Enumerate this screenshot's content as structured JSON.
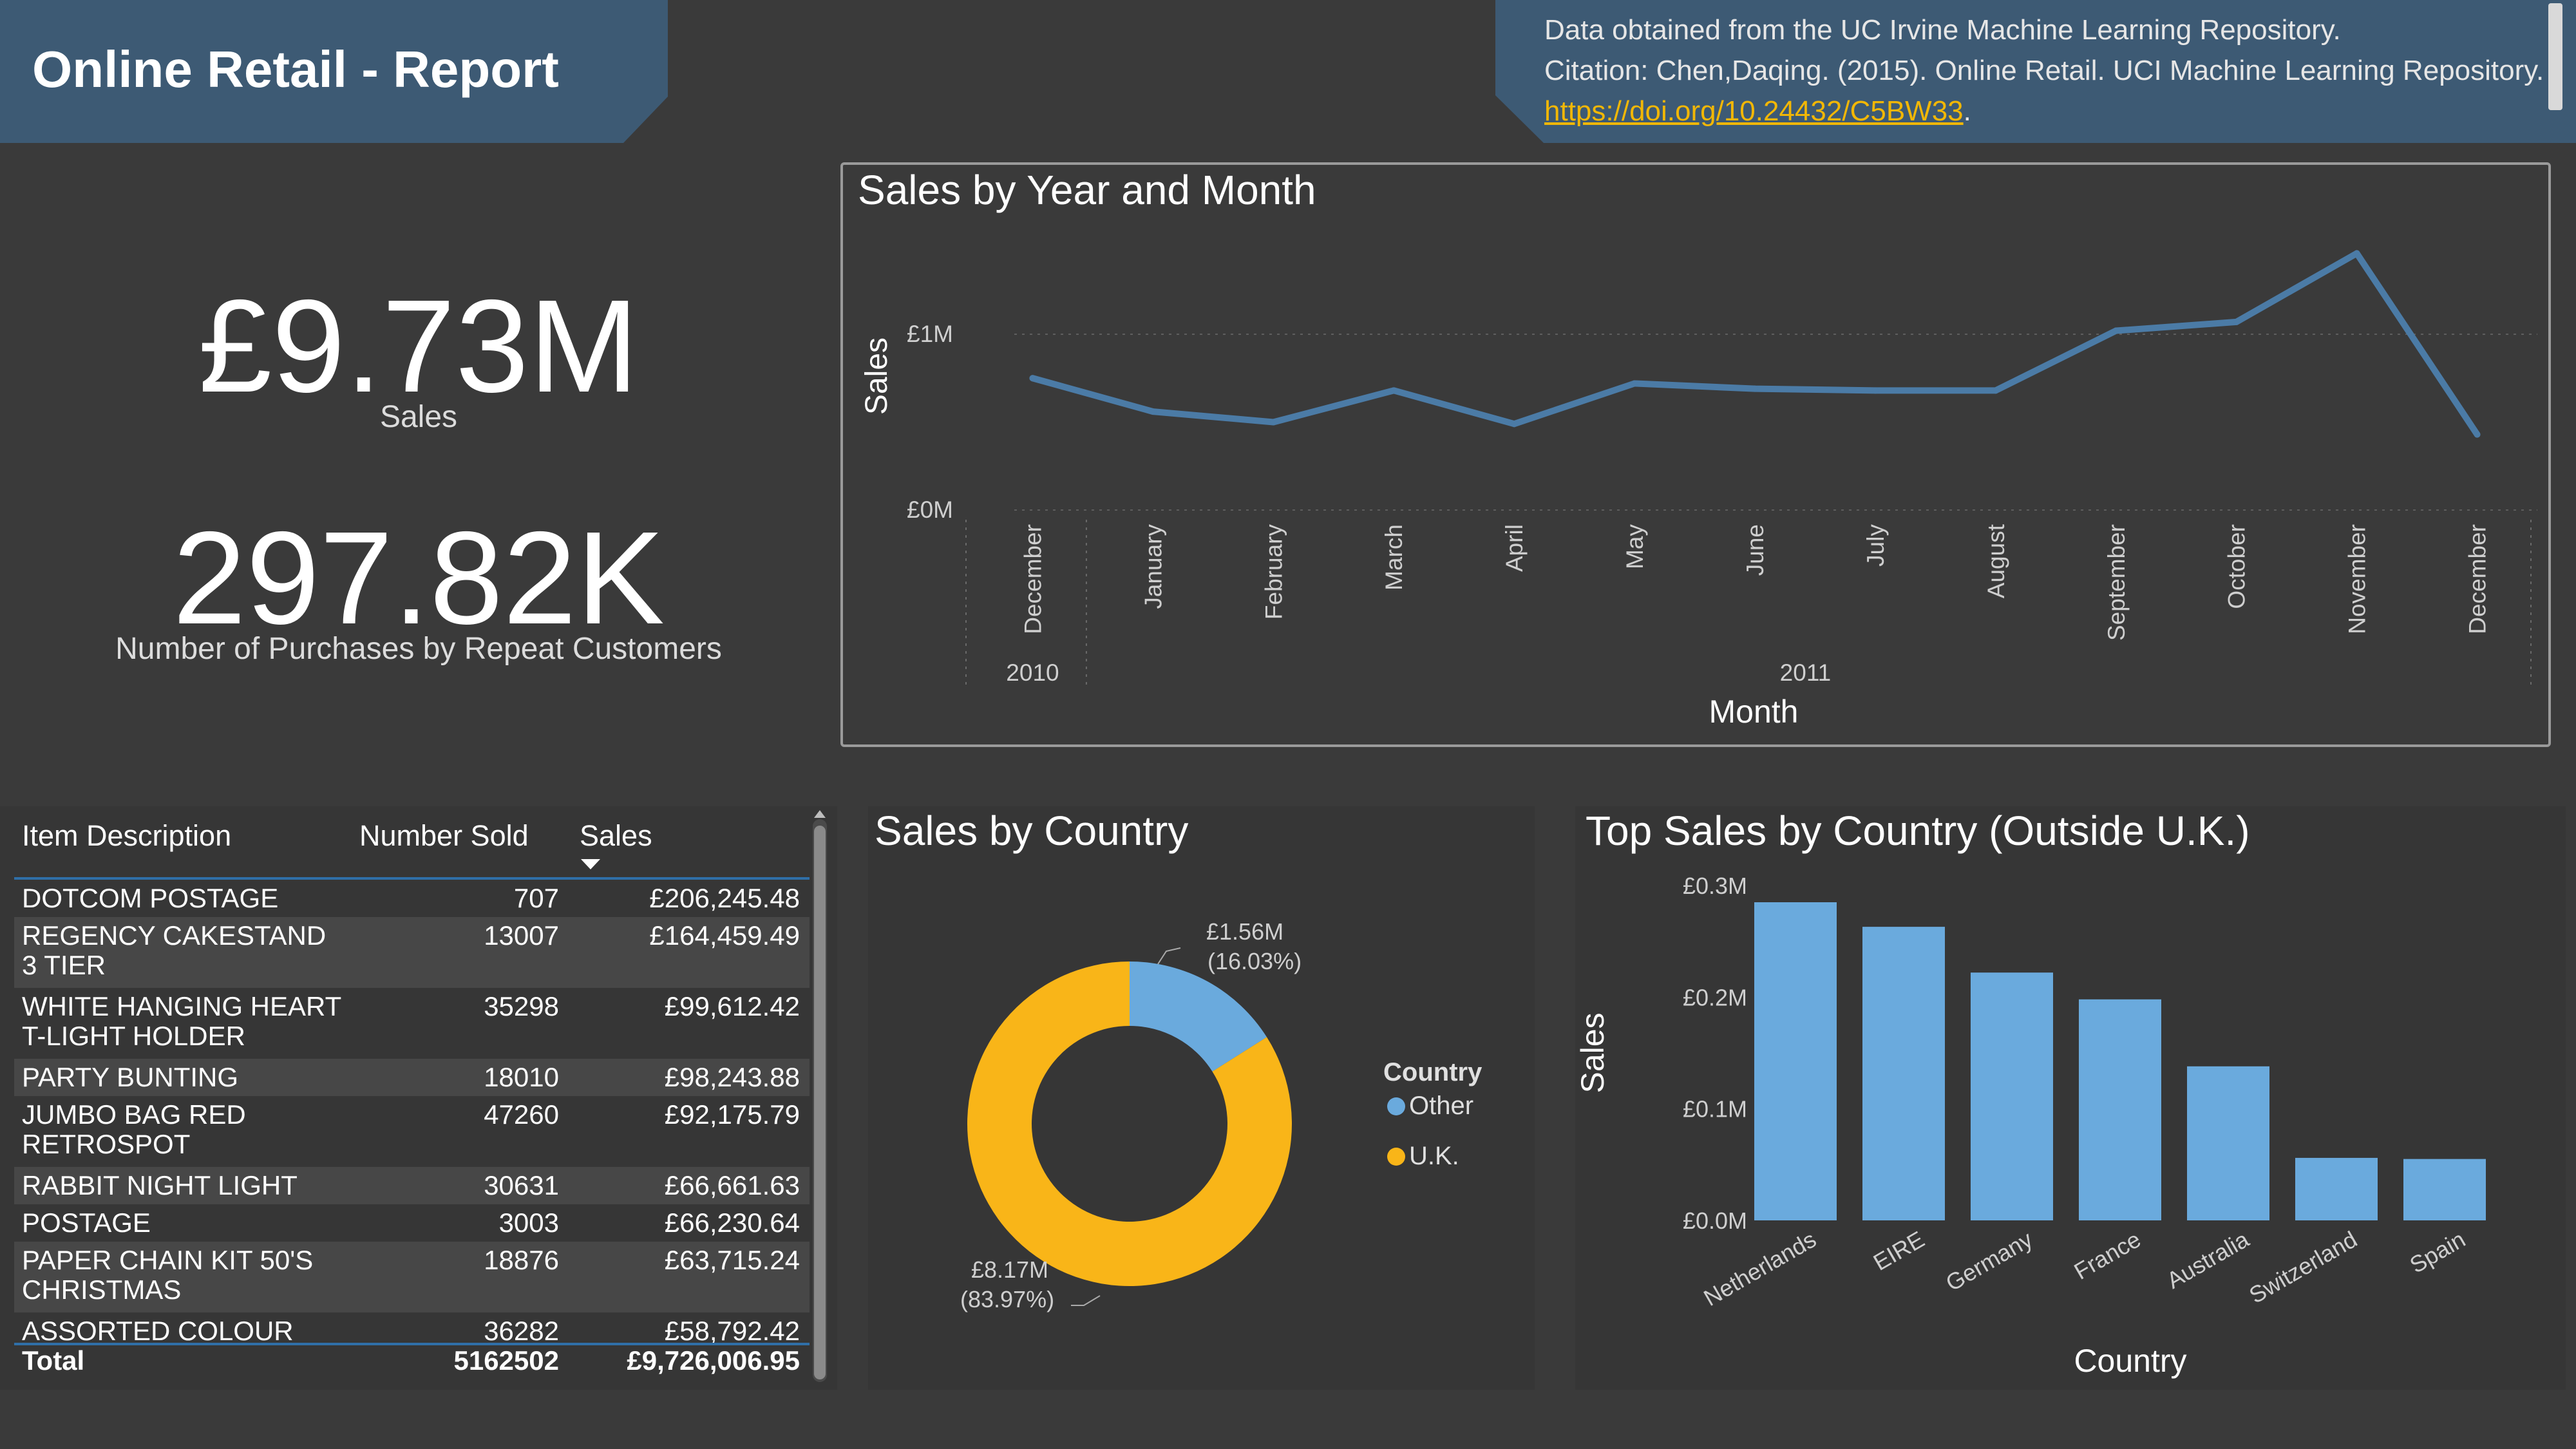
{
  "header": {
    "title": "Online Retail - Report",
    "citation_line1": "Data obtained from the UC Irvine Machine Learning Repository.",
    "citation_line2": "Citation: Chen,Daqing. (2015). Online Retail. UCI Machine Learning Repository.",
    "citation_link": "https://doi.org/10.24432/C5BW33",
    "citation_period": "."
  },
  "kpis": {
    "sales_value": "£9.73M",
    "sales_label": "Sales",
    "purchases_value": "297.82K",
    "purchases_label": "Number of Purchases by Repeat Customers"
  },
  "colors": {
    "background": "#3a3a3a",
    "banner": "#3d5a74",
    "line": "#4b7ba6",
    "bar": "#6aaadd",
    "uk": "#f9b518",
    "other": "#6aaadd",
    "table_accent": "#2f6fa8",
    "link": "#f2b705"
  },
  "table": {
    "headers": [
      "Item Description",
      "Number Sold",
      "Sales"
    ],
    "rows": [
      {
        "desc": "DOTCOM POSTAGE",
        "sold": "707",
        "sales": "£206,245.48"
      },
      {
        "desc": "REGENCY CAKESTAND\n3 TIER",
        "sold": "13007",
        "sales": "£164,459.49"
      },
      {
        "desc": "WHITE HANGING HEART\nT-LIGHT HOLDER",
        "sold": "35298",
        "sales": "£99,612.42"
      },
      {
        "desc": "PARTY BUNTING",
        "sold": "18010",
        "sales": "£98,243.88"
      },
      {
        "desc": "JUMBO BAG RED\nRETROSPOT",
        "sold": "47260",
        "sales": "£92,175.79"
      },
      {
        "desc": "RABBIT NIGHT LIGHT",
        "sold": "30631",
        "sales": "£66,661.63"
      },
      {
        "desc": "POSTAGE",
        "sold": "3003",
        "sales": "£66,230.64"
      },
      {
        "desc": "PAPER CHAIN KIT 50'S\nCHRISTMAS",
        "sold": "18876",
        "sales": "£63,715.24"
      },
      {
        "desc": "ASSORTED COLOUR",
        "sold": "36282",
        "sales": "£58,792.42"
      }
    ],
    "total_label": "Total",
    "total_sold": "5162502",
    "total_sales": "£9,726,006.95"
  },
  "chart_data": [
    {
      "type": "line",
      "title": "Sales by Year and Month",
      "xlabel": "Month",
      "ylabel": "Sales",
      "x": [
        "December",
        "January",
        "February",
        "March",
        "April",
        "May",
        "June",
        "July",
        "August",
        "September",
        "October",
        "November",
        "December"
      ],
      "year_groups": [
        {
          "label": "2010",
          "count": 1
        },
        {
          "label": "2011",
          "count": 12
        }
      ],
      "values": [
        750000,
        560000,
        500000,
        680000,
        490000,
        720000,
        690000,
        680000,
        680000,
        1020000,
        1070000,
        1460000,
        430000
      ],
      "y_ticks": [
        {
          "value": 0,
          "label": "£0M"
        },
        {
          "value": 1000000,
          "label": "£1M"
        }
      ],
      "ylim": [
        0,
        1500000
      ],
      "grid": true
    },
    {
      "type": "pie",
      "title": "Sales by Country",
      "legend_title": "Country",
      "legend_position": "right",
      "slices": [
        {
          "name": "Other",
          "value": 1560000,
          "label": "£1.56M",
          "percent_label": "(16.03%)"
        },
        {
          "name": "U.K.",
          "value": 8170000,
          "label": "£8.17M",
          "percent_label": "(83.97%)"
        }
      ]
    },
    {
      "type": "bar",
      "title": "Top Sales by Country (Outside U.K.)",
      "xlabel": "Country",
      "ylabel": "Sales",
      "categories": [
        "Netherlands",
        "EIRE",
        "Germany",
        "France",
        "Australia",
        "Switzerland",
        "Spain"
      ],
      "values": [
        285000,
        263000,
        222000,
        198000,
        138000,
        56000,
        55000
      ],
      "y_ticks": [
        {
          "value": 0,
          "label": "£0.0M"
        },
        {
          "value": 100000,
          "label": "£0.1M"
        },
        {
          "value": 200000,
          "label": "£0.2M"
        },
        {
          "value": 300000,
          "label": "£0.3M"
        }
      ],
      "ylim": [
        0,
        300000
      ],
      "grid": false
    }
  ]
}
